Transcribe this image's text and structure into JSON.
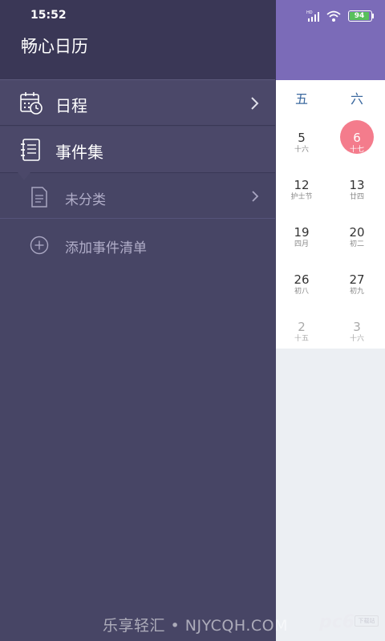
{
  "status_bar": {
    "time": "15:52",
    "battery": "94",
    "network": "HD"
  },
  "drawer": {
    "app_title": "畅心日历",
    "items": [
      {
        "label": "日程",
        "icon": "calendar-clock-icon"
      },
      {
        "label": "事件集",
        "icon": "notebook-icon"
      }
    ],
    "sub_items": [
      {
        "label": "未分类",
        "icon": "document-icon"
      }
    ],
    "add_label": "添加事件清单"
  },
  "calendar": {
    "weekday_headers": [
      "五",
      "六"
    ],
    "rows": [
      [
        {
          "day": "5",
          "lunar": "十六"
        },
        {
          "day": "6",
          "lunar": "十七",
          "selected": true
        }
      ],
      [
        {
          "day": "12",
          "lunar": "护士节"
        },
        {
          "day": "13",
          "lunar": "廿四"
        }
      ],
      [
        {
          "day": "19",
          "lunar": "四月"
        },
        {
          "day": "20",
          "lunar": "初二"
        }
      ],
      [
        {
          "day": "26",
          "lunar": "初八"
        },
        {
          "day": "27",
          "lunar": "初九"
        }
      ],
      [
        {
          "day": "2",
          "lunar": "十五"
        },
        {
          "day": "3",
          "lunar": "十六"
        }
      ]
    ],
    "colors": {
      "header": "#7b6bb8",
      "today": "#f47c8c",
      "weekday": "#3d6aa0"
    }
  },
  "watermark": {
    "text": "乐享轻汇 • NJYCQH.COM",
    "logo": "pc6",
    "logo_sub": "下载站"
  },
  "colors": {
    "drawer_bg": "#474565",
    "drawer_header": "#3a3756"
  }
}
